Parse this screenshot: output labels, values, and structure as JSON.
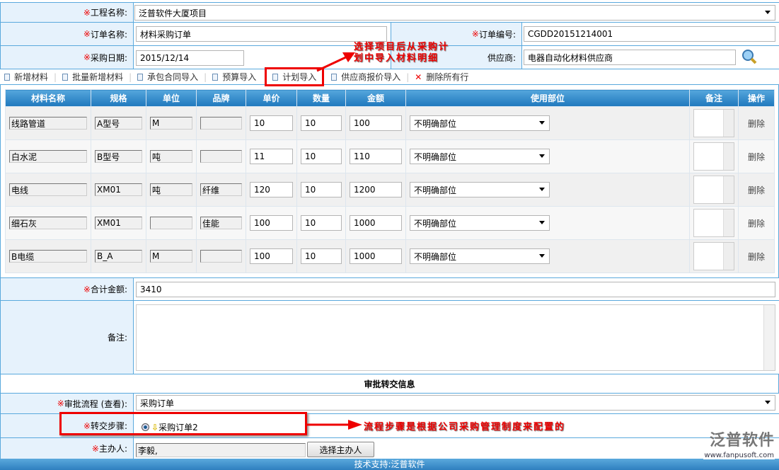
{
  "form": {
    "project_label": "工程名称:",
    "project_value": "泛普软件大厦项目",
    "order_name_label": "订单名称:",
    "order_name_value": "材料采购订单",
    "order_no_label": "订单编号:",
    "order_no_value": "CGDD20151214001",
    "date_label": "采购日期:",
    "date_value": "2015/12/14",
    "supplier_label": "供应商:",
    "supplier_value": "电器自动化材料供应商",
    "required_mark": "※"
  },
  "toolbar": [
    "新增材料",
    "批量新增材料",
    "承包合同导入",
    "预算导入",
    "计划导入",
    "供应商报价导入"
  ],
  "toolbar_delete": "删除所有行",
  "table": {
    "headers": [
      "材料名称",
      "规格",
      "单位",
      "品牌",
      "单价",
      "数量",
      "金额",
      "使用部位",
      "备注",
      "操作"
    ],
    "rows": [
      {
        "name": "线路管道",
        "spec": "A型号",
        "unit": "M",
        "brand": "",
        "price": "10",
        "qty": "10",
        "amount": "100",
        "dept": "不明确部位",
        "op": "删除"
      },
      {
        "name": "白水泥",
        "spec": "B型号",
        "unit": "吨",
        "brand": "",
        "price": "11",
        "qty": "10",
        "amount": "110",
        "dept": "不明确部位",
        "op": "删除"
      },
      {
        "name": "电线",
        "spec": "XM01",
        "unit": "吨",
        "brand": "纤维",
        "price": "120",
        "qty": "10",
        "amount": "1200",
        "dept": "不明确部位",
        "op": "删除"
      },
      {
        "name": "细石灰",
        "spec": "XM01",
        "unit": "",
        "brand": "佳能",
        "price": "100",
        "qty": "10",
        "amount": "1000",
        "dept": "不明确部位",
        "op": "删除"
      },
      {
        "name": "B电缆",
        "spec": "B_A",
        "unit": "M",
        "brand": "",
        "price": "100",
        "qty": "10",
        "amount": "1000",
        "dept": "不明确部位",
        "op": "删除"
      }
    ]
  },
  "total_label": "合计金额:",
  "total_value": "3410",
  "remark_label": "备注:",
  "section_title": "审批转交信息",
  "process_label": "审批流程 (查看):",
  "process_value": "采购订单",
  "step_label": "转交步骤:",
  "step_value": "采购订单2",
  "owner_label": "主办人:",
  "owner_value": "李毅,",
  "owner_button": "选择主办人",
  "callout1": "选择项目后从采购计划中导入材料明细",
  "callout1_line1": "选择项目后从采购计",
  "callout1_line2": "划中导入材料明细",
  "callout2": "流程步骤是根据公司采购管理制度来配置的",
  "logo": "泛普软件",
  "logo_url": "www.fanpusoft.com",
  "footer": "技术支持:泛普软件"
}
